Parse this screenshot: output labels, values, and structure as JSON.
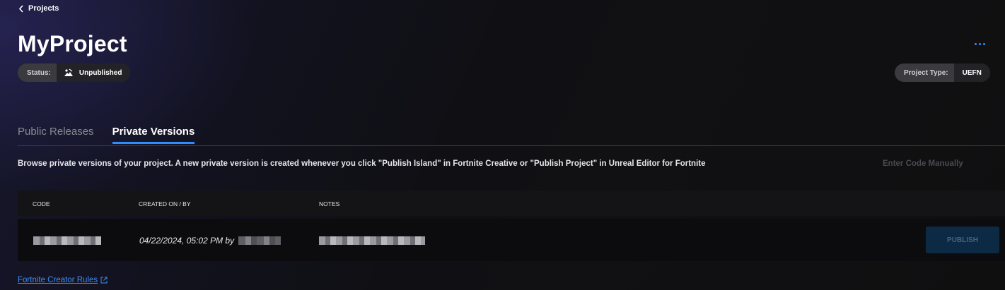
{
  "breadcrumb": {
    "back_label": "Projects",
    "icon": "chevron-left-icon"
  },
  "project": {
    "title": "MyProject",
    "status_key": "Status:",
    "status_value": "Unpublished",
    "status_icon": "unpublished-icon",
    "type_key": "Project Type:",
    "type_value": "UEFN"
  },
  "menu": {
    "more_icon": "more-horizontal-icon"
  },
  "tabs": [
    {
      "label": "Public Releases",
      "active": false
    },
    {
      "label": "Private Versions",
      "active": true
    }
  ],
  "description": "Browse private versions of your project. A new private version is created whenever you click \"Publish Island\" in Fortnite Creative or \"Publish Project\" in Unreal Editor for Fortnite",
  "enter_code_label": "Enter Code Manually",
  "table": {
    "columns": [
      "CODE",
      "CREATED ON / BY",
      "NOTES"
    ],
    "rows": [
      {
        "created": "04/22/2024, 05:02 PM by",
        "publish_label": "PUBLISH"
      }
    ]
  },
  "footer": {
    "rules_link": "Fortnite Creator Rules",
    "external_icon": "external-link-icon"
  },
  "colors": {
    "accent": "#2f8cff",
    "link": "#3d8ef5",
    "publish_bg": "#0d2a44"
  }
}
